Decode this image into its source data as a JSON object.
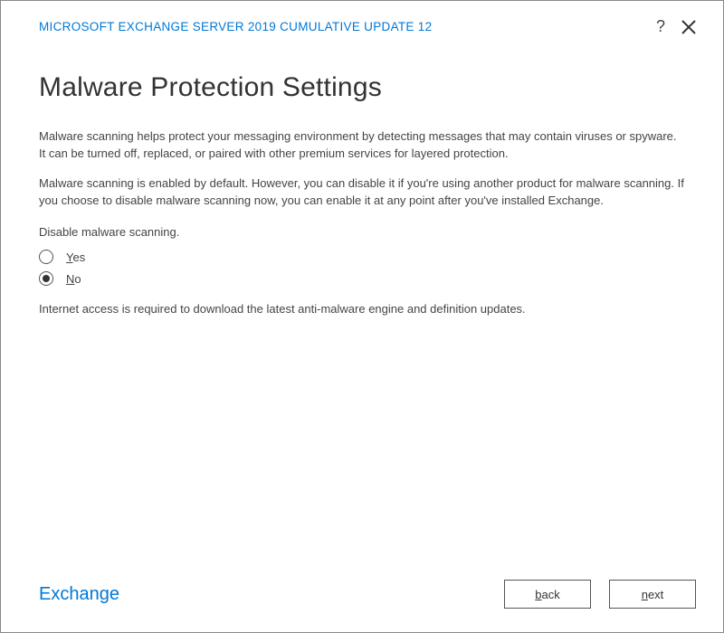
{
  "header": {
    "title": "MICROSOFT EXCHANGE SERVER 2019 CUMULATIVE UPDATE 12"
  },
  "page": {
    "title": "Malware Protection Settings",
    "description1": "Malware scanning helps protect your messaging environment by detecting messages that may contain viruses or spyware. It can be turned off, replaced, or paired with other premium services for layered protection.",
    "description2": "Malware scanning is enabled by default. However, you can disable it if you're using another product for malware scanning. If you choose to disable malware scanning now, you can enable it at any point after you've installed Exchange.",
    "question": "Disable malware scanning.",
    "options": {
      "yes": "Yes",
      "no": "No",
      "selected": "no"
    },
    "note": "Internet access is required to download the latest anti-malware engine and definition updates."
  },
  "footer": {
    "brand": "Exchange",
    "back_label": "back",
    "next_label": "next"
  }
}
